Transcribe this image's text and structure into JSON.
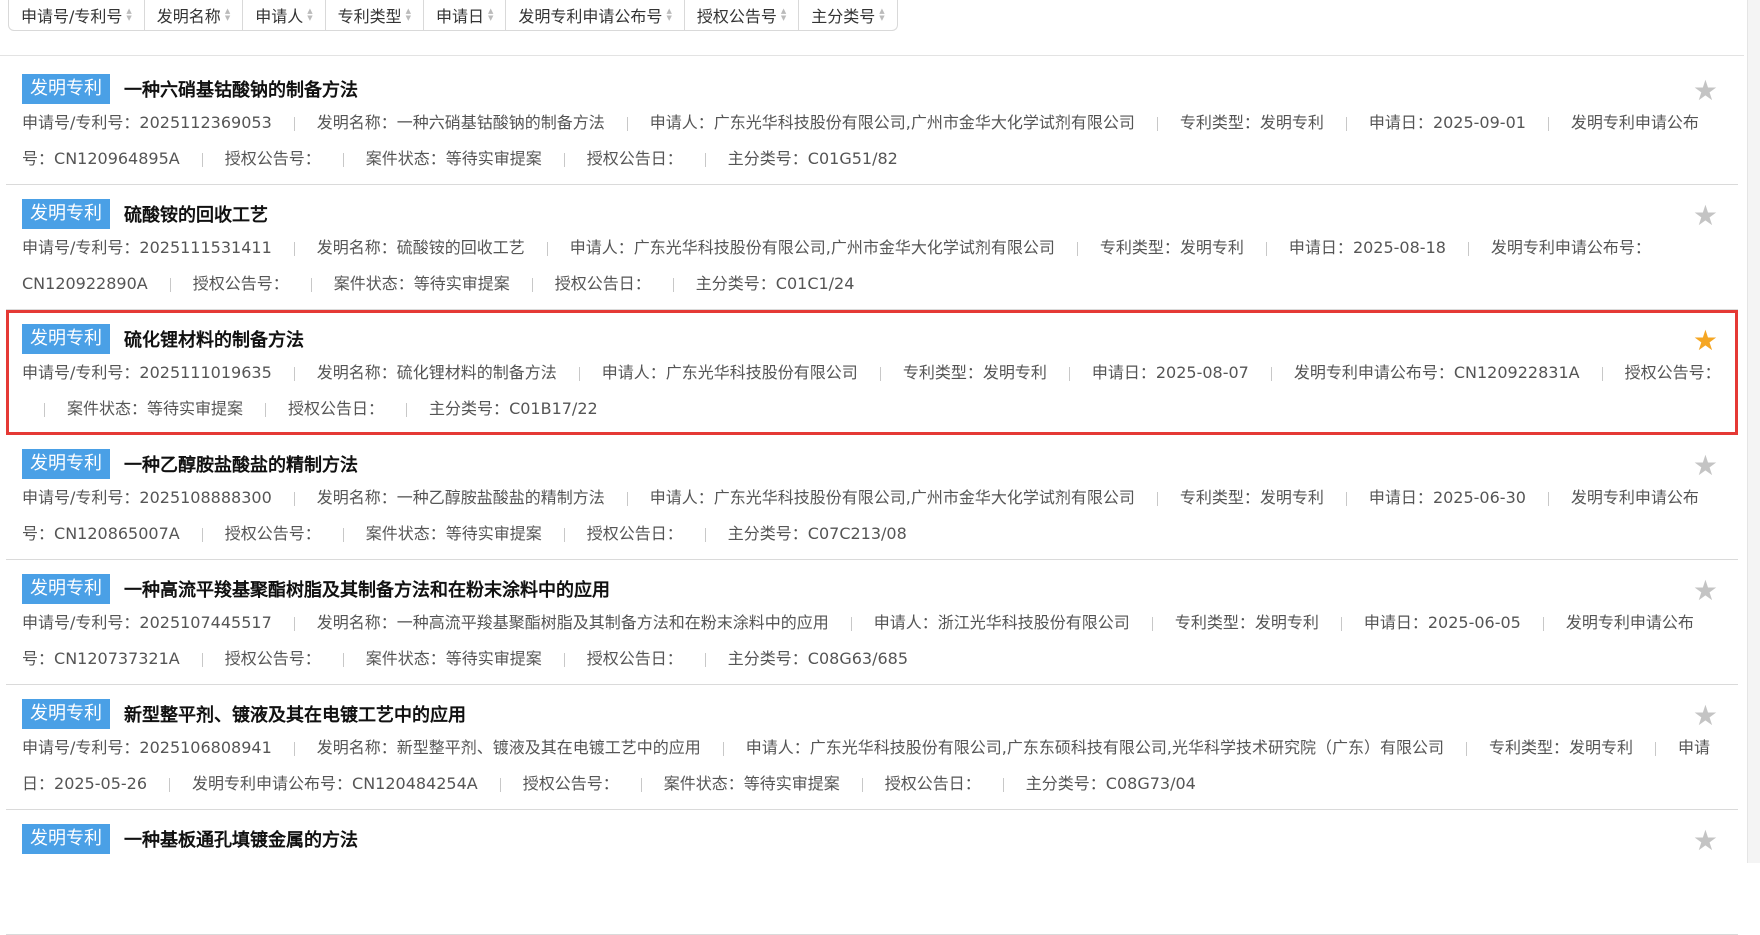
{
  "sort_bar": [
    "申请号/专利号",
    "发明名称",
    "申请人",
    "专利类型",
    "申请日",
    "发明专利申请公布号",
    "授权公告号",
    "主分类号"
  ],
  "labels": {
    "app_no": "申请号/专利号：",
    "name": "发明名称：",
    "applicant": "申请人：",
    "type": "专利类型：",
    "date": "申请日：",
    "pub_no": "发明专利申请公布号：",
    "grant_no": "授权公告号：",
    "status": "案件状态：",
    "grant_date": "授权公告日：",
    "ipc": "主分类号："
  },
  "colors": {
    "badge": "#4aa0e6",
    "star_active": "#f5a623",
    "highlight": "#e53935"
  },
  "items": [
    {
      "badge": "发明专利",
      "title": "一种六硝基钴酸钠的制备方法",
      "app_no": "2025112369053",
      "name": "一种六硝基钴酸钠的制备方法",
      "applicant": "广东光华科技股份有限公司,广州市金华大化学试剂有限公司",
      "type": "发明专利",
      "date": "2025-09-01",
      "pub_no": "CN120964895A",
      "grant_no": "",
      "status": "等待实审提案",
      "grant_date": "",
      "ipc": "C01G51/82",
      "starred": false
    },
    {
      "badge": "发明专利",
      "title": "硫酸铵的回收工艺",
      "app_no": "2025111531411",
      "name": "硫酸铵的回收工艺",
      "applicant": "广东光华科技股份有限公司,广州市金华大化学试剂有限公司",
      "type": "发明专利",
      "date": "2025-08-18",
      "pub_no": "CN120922890A",
      "grant_no": "",
      "status": "等待实审提案",
      "grant_date": "",
      "ipc": "C01C1/24",
      "starred": false
    },
    {
      "badge": "发明专利",
      "title": "硫化锂材料的制备方法",
      "app_no": "2025111019635",
      "name": "硫化锂材料的制备方法",
      "applicant": "广东光华科技股份有限公司",
      "type": "发明专利",
      "date": "2025-08-07",
      "pub_no": "CN120922831A",
      "grant_no": "",
      "status": "等待实审提案",
      "grant_date": "",
      "ipc": "C01B17/22",
      "starred": true
    },
    {
      "badge": "发明专利",
      "title": "一种乙醇胺盐酸盐的精制方法",
      "app_no": "2025108888300",
      "name": "一种乙醇胺盐酸盐的精制方法",
      "applicant": "广东光华科技股份有限公司,广州市金华大化学试剂有限公司",
      "type": "发明专利",
      "date": "2025-06-30",
      "pub_no": "CN120865007A",
      "grant_no": "",
      "status": "等待实审提案",
      "grant_date": "",
      "ipc": "C07C213/08",
      "starred": false
    },
    {
      "badge": "发明专利",
      "title": "一种高流平羧基聚酯树脂及其制备方法和在粉末涂料中的应用",
      "app_no": "2025107445517",
      "name": "一种高流平羧基聚酯树脂及其制备方法和在粉末涂料中的应用",
      "applicant": "浙江光华科技股份有限公司",
      "type": "发明专利",
      "date": "2025-06-05",
      "pub_no": "CN120737321A",
      "grant_no": "",
      "status": "等待实审提案",
      "grant_date": "",
      "ipc": "C08G63/685",
      "starred": false
    },
    {
      "badge": "发明专利",
      "title": "新型整平剂、镀液及其在电镀工艺中的应用",
      "app_no": "2025106808941",
      "name": "新型整平剂、镀液及其在电镀工艺中的应用",
      "applicant": "广东光华科技股份有限公司,广东东硕科技有限公司,光华科学技术研究院（广东）有限公司",
      "type": "发明专利",
      "date": "2025-05-26",
      "pub_no": "CN120484254A",
      "grant_no": "",
      "status": "等待实审提案",
      "grant_date": "",
      "ipc": "C08G73/04",
      "starred": false
    },
    {
      "badge": "发明专利",
      "title": "一种基板通孔填镀金属的方法",
      "starred": false,
      "partial": true
    }
  ]
}
